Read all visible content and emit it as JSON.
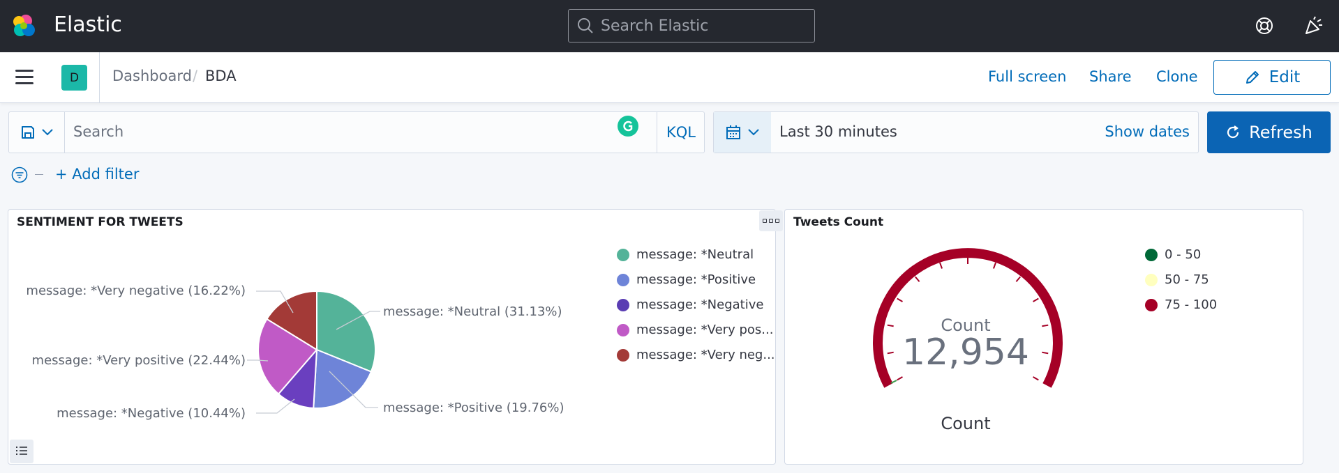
{
  "app": {
    "brand": "Elastic",
    "search_placeholder": "Search Elastic"
  },
  "nav": {
    "space_initial": "D",
    "breadcrumb": [
      "Dashboard",
      "BDA"
    ],
    "breadcrumb_separator": "/",
    "links": {
      "full_screen": "Full screen",
      "share": "Share",
      "clone": "Clone",
      "edit": "Edit"
    }
  },
  "query": {
    "placeholder": "Search",
    "language": "KQL"
  },
  "time": {
    "range": "Last 30 minutes",
    "show_dates": "Show dates",
    "refresh": "Refresh"
  },
  "filters": {
    "add_label": "+ Add filter"
  },
  "panels": {
    "pie": {
      "title": "SENTIMENT FOR TWEETS",
      "legend": [
        {
          "label": "message: *Neutral",
          "color": "#54b399"
        },
        {
          "label": "message: *Positive",
          "color": "#6092c0"
        },
        {
          "label": "message: *Negative",
          "color": "#5a3db3"
        },
        {
          "label": "message: *Very pos...",
          "color": "#b752b3"
        },
        {
          "label": "message: *Very neg...",
          "color": "#a33a37"
        }
      ],
      "callouts": {
        "neutral": "message: *Neutral (31.13%)",
        "positive": "message: *Positive (19.76%)",
        "negative": "message: *Negative (10.44%)",
        "very_positive": "message: *Very positive (22.44%)",
        "very_negative": "message: *Very negative (16.22%)"
      }
    },
    "gauge": {
      "title": "Tweets Count",
      "value": "12,954",
      "inner_label": "Count",
      "bottom_label": "Count",
      "ranges": [
        {
          "label": "0 - 50",
          "color": "#006837"
        },
        {
          "label": "50 - 75",
          "color": "#ffffbf"
        },
        {
          "label": "75 - 100",
          "color": "#a50026"
        }
      ]
    }
  },
  "chart_data": {
    "type": "pie",
    "title": "SENTIMENT FOR TWEETS",
    "categories": [
      "message: *Neutral",
      "message: *Positive",
      "message: *Negative",
      "message: *Very positive",
      "message: *Very negative"
    ],
    "values": [
      31.13,
      19.76,
      10.44,
      22.44,
      16.22
    ],
    "colors": [
      "#54b399",
      "#6e84d8",
      "#6a3fbf",
      "#c05ac6",
      "#a33a37"
    ],
    "legend_position": "right"
  }
}
